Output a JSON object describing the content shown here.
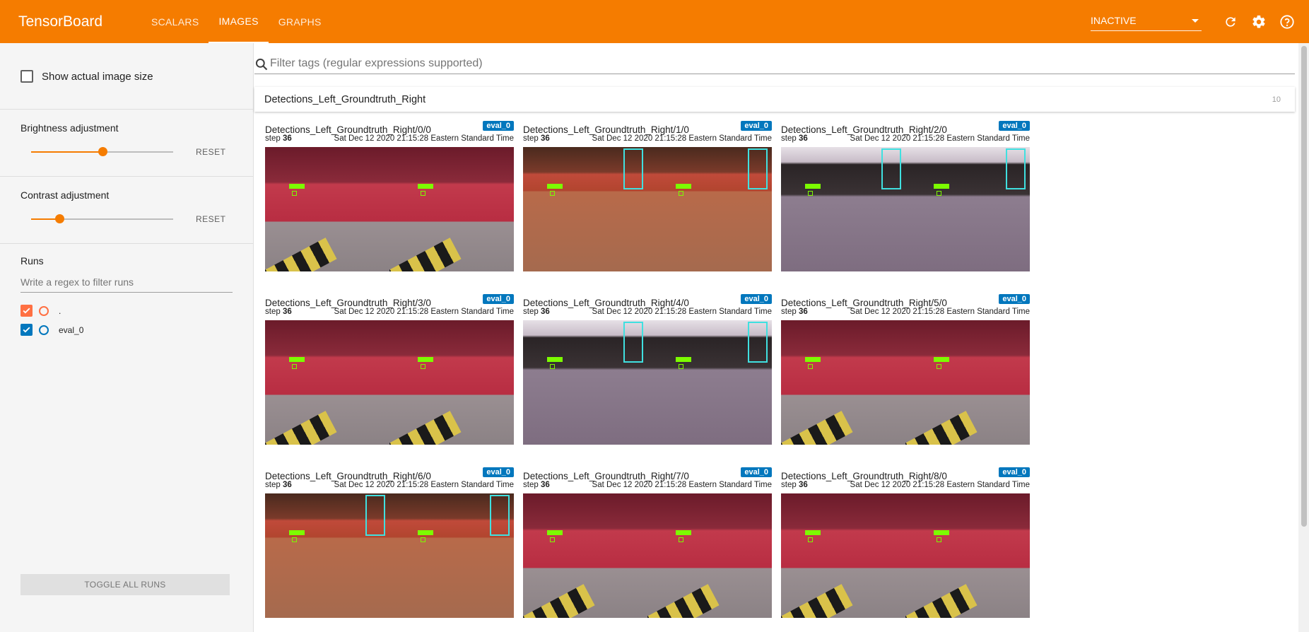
{
  "header": {
    "brand": "TensorBoard",
    "tabs": [
      {
        "label": "SCALARS",
        "active": false
      },
      {
        "label": "IMAGES",
        "active": true
      },
      {
        "label": "GRAPHS",
        "active": false
      }
    ],
    "status": "INACTIVE",
    "icons": [
      "refresh-icon",
      "settings-icon",
      "help-icon"
    ]
  },
  "sidebar": {
    "show_actual_size": "Show actual image size",
    "brightness_label": "Brightness adjustment",
    "brightness_value": 0.5,
    "contrast_label": "Contrast adjustment",
    "contrast_value": 0.2,
    "reset_label": "RESET",
    "runs_title": "Runs",
    "runs_filter_placeholder": "Write a regex to filter runs",
    "runs": [
      {
        "name": ".",
        "color": "#ff7043"
      },
      {
        "name": "eval_0",
        "color": "#0277bd"
      }
    ],
    "toggle_all": "TOGGLE ALL RUNS"
  },
  "main": {
    "tag_filter_placeholder": "Filter tags (regular expressions supported)",
    "group_title": "Detections_Left_Groundtruth_Right",
    "group_count": "10",
    "cards": [
      {
        "title": "Detections_Left_Groundtruth_Right/0/0",
        "run": "eval_0",
        "step_label": "step",
        "step": "36",
        "time": "Sat Dec 12 2020 21:15:28 Eastern Standard Time",
        "scene": "hall"
      },
      {
        "title": "Detections_Left_Groundtruth_Right/1/0",
        "run": "eval_0",
        "step_label": "step",
        "step": "36",
        "time": "Sat Dec 12 2020 21:15:28 Eastern Standard Time",
        "scene": "wood"
      },
      {
        "title": "Detections_Left_Groundtruth_Right/2/0",
        "run": "eval_0",
        "step_label": "step",
        "step": "36",
        "time": "Sat Dec 12 2020 21:15:28 Eastern Standard Time",
        "scene": "purple"
      },
      {
        "title": "Detections_Left_Groundtruth_Right/3/0",
        "run": "eval_0",
        "step_label": "step",
        "step": "36",
        "time": "Sat Dec 12 2020 21:15:28 Eastern Standard Time",
        "scene": "hall"
      },
      {
        "title": "Detections_Left_Groundtruth_Right/4/0",
        "run": "eval_0",
        "step_label": "step",
        "step": "36",
        "time": "Sat Dec 12 2020 21:15:28 Eastern Standard Time",
        "scene": "purple"
      },
      {
        "title": "Detections_Left_Groundtruth_Right/5/0",
        "run": "eval_0",
        "step_label": "step",
        "step": "36",
        "time": "Sat Dec 12 2020 21:15:28 Eastern Standard Time",
        "scene": "hall"
      },
      {
        "title": "Detections_Left_Groundtruth_Right/6/0",
        "run": "eval_0",
        "step_label": "step",
        "step": "36",
        "time": "Sat Dec 12 2020 21:15:28 Eastern Standard Time",
        "scene": "wood"
      },
      {
        "title": "Detections_Left_Groundtruth_Right/7/0",
        "run": "eval_0",
        "step_label": "step",
        "step": "36",
        "time": "Sat Dec 12 2020 21:15:28 Eastern Standard Time",
        "scene": "hall"
      },
      {
        "title": "Detections_Left_Groundtruth_Right/8/0",
        "run": "eval_0",
        "step_label": "step",
        "step": "36",
        "time": "Sat Dec 12 2020 21:15:28 Eastern Standard Time",
        "scene": "hall"
      }
    ]
  }
}
